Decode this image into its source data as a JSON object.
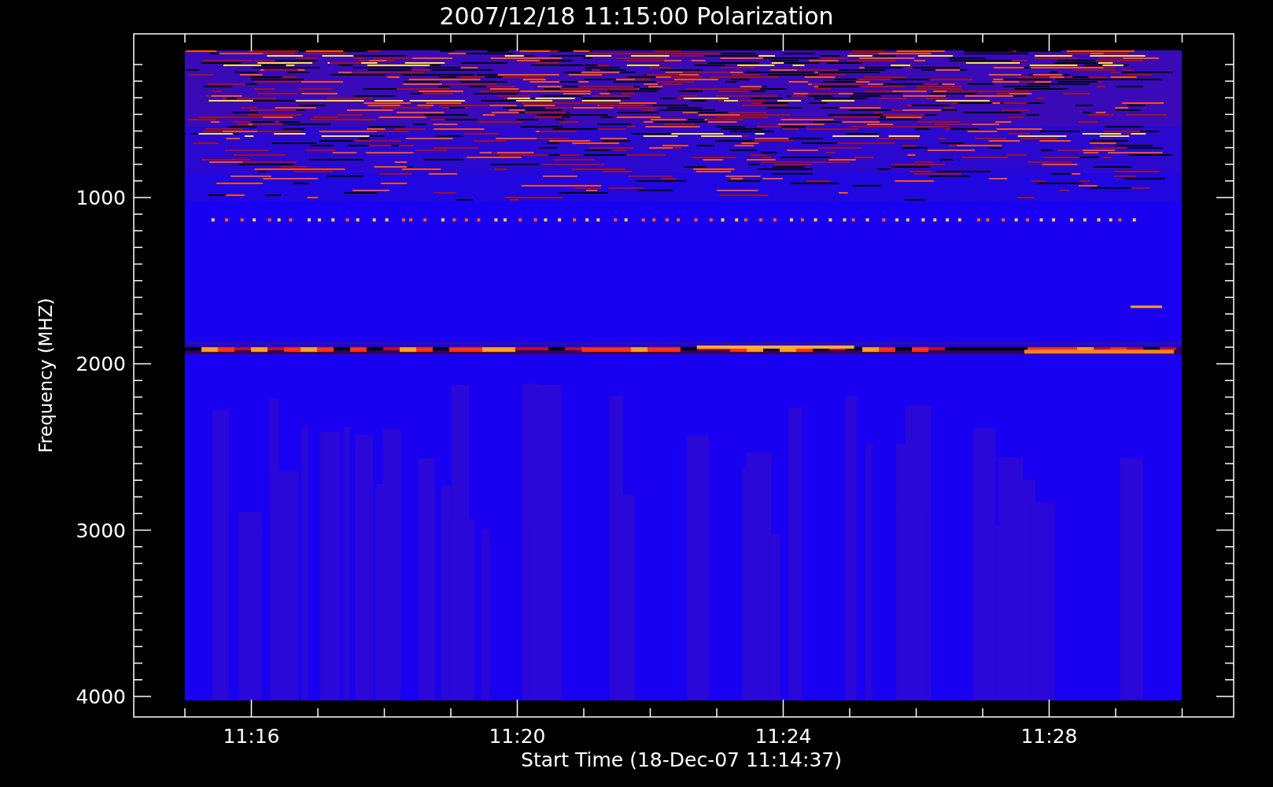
{
  "plot": {
    "title": "2007/12/18 11:15:00 Polarization",
    "ylabel": "Frequency (MHZ)",
    "xlabel": "Start Time (18-Dec-07 11:14:37)",
    "y_tick_labels": [
      "1000",
      "2000",
      "3000",
      "4000"
    ],
    "x_tick_labels": [
      "11:16",
      "11:20",
      "11:24",
      "11:28"
    ]
  }
}
